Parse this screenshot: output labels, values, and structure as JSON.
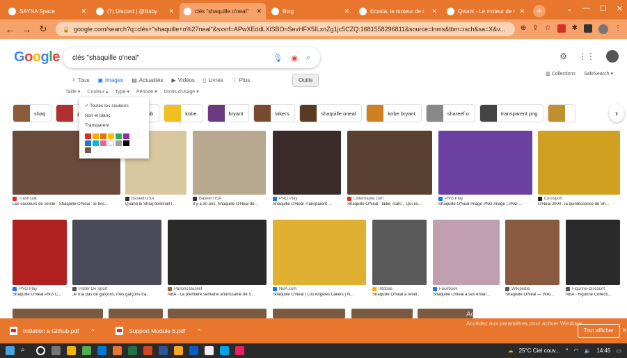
{
  "tabs": [
    {
      "label": "SAYNA Space",
      "icon": "sayna-icon",
      "active": false
    },
    {
      "label": "(7) Discord | @Baby",
      "icon": "discord-icon",
      "active": false
    },
    {
      "label": "clés \"shaquille o'neal\"",
      "icon": "google-icon",
      "active": true
    },
    {
      "label": "Bing",
      "icon": "bing-icon",
      "active": false
    },
    {
      "label": "Ecosia, le moteur de r",
      "icon": "ecosia-icon",
      "active": false
    },
    {
      "label": "Qwant - Le moteur de r",
      "icon": "qwant-icon",
      "active": false
    }
  ],
  "address": {
    "url": "google.com/search?q=clés+\"shaquille+o%27neal\"&sxsrf=APwXEddLXiSBOnSevHFX5ILxnZg1jc5CZQ:1681558296811&source=lnms&tbm=isch&sa=X&v..."
  },
  "search": {
    "query": "clés \"shaquille o'neal\""
  },
  "nav": {
    "tous": "Tous",
    "images": "Images",
    "actualites": "Actualités",
    "videos": "Vidéos",
    "livres": "Livres",
    "plus": "Plus",
    "outils": "Outils",
    "collections": "Collections",
    "safesearch": "SafeSearch ▾"
  },
  "filters": {
    "taille": "Taille ▾",
    "couleur": "Couleur ▴",
    "type": "Type ▾",
    "periode": "Période ▾",
    "droits": "Droits d'usage ▾"
  },
  "dropdown": {
    "items": [
      "Toutes les couleurs",
      "Noir et blanc",
      "Transparent"
    ],
    "swatches": [
      "#d93025",
      "#f9ab00",
      "#e37400",
      "#fbbc04",
      "#34a853",
      "#9c27b0",
      "#1a73e8",
      "#00bcd4",
      "#f06292",
      "#ffffff",
      "#9e9e9e",
      "#000000",
      "#795548"
    ]
  },
  "chips": [
    {
      "label": "shaq",
      "color": "#8a5a3a"
    },
    {
      "label": "p",
      "color": "#b03030"
    },
    {
      "label": "chateau nightclub",
      "color": "#333"
    },
    {
      "label": "kobe",
      "color": "#f0c020"
    },
    {
      "label": "bryant",
      "color": "#6a3a80"
    },
    {
      "label": "lakers",
      "color": "#7a4a30"
    },
    {
      "label": "shaquille oneal",
      "color": "#5a3a20"
    },
    {
      "label": "kobe bryant",
      "color": "#d08020"
    },
    {
      "label": "shareef o",
      "color": "#888"
    },
    {
      "label": "transparent png",
      "color": "#444"
    },
    {
      "label": "",
      "color": "#c09030"
    }
  ],
  "row1": [
    {
      "source": "TrashTalk",
      "caption": "Les casseurs de cercle - Shaquille O'Neal : le bos...",
      "color": "#6a4a3a",
      "dot": "#d93025"
    },
    {
      "source": "",
      "caption": "",
      "color": "#e8b030",
      "dot": "#333"
    },
    {
      "source": "Basket USA",
      "caption": "Quand le Shaq dominait l...",
      "color": "#d9c7a0",
      "dot": "#333"
    },
    {
      "source": "Basket USA",
      "caption": "Il y a 30 ans, Shaquille O'Neal dé...",
      "color": "#b8a890",
      "dot": "#333"
    },
    {
      "source": "PNG Play",
      "caption": "Shaquille O'Neal Transparent ...",
      "color": "#3a2a2a",
      "dot": "#1a73e8"
    },
    {
      "source": "Linternaute.com",
      "caption": "Shaquille O'Neal : taille, stats... Qui es...",
      "color": "#5a4030",
      "dot": "#d93025"
    },
    {
      "source": "PNG Play",
      "caption": "Shaquille O'Neal Image PNG Image | PNG ...",
      "color": "#6a40a0",
      "dot": "#1a73e8"
    },
    {
      "source": "Eurosport",
      "caption": "O'Neal 2000 : la quintessence de Sh...",
      "color": "#d0a020",
      "dot": "#222"
    }
  ],
  "row2": [
    {
      "source": "PNG Play",
      "caption": "Shaquille O'Neal PNG C...",
      "color": "#b02020",
      "dot": "#1a73e8"
    },
    {
      "source": "Parler De Sport",
      "caption": "Je n'ai pas de garçons, mes garçons tra...",
      "color": "#4a4a5a",
      "dot": "#555"
    },
    {
      "source": "Parions Basket",
      "caption": "NBA - La première semaine ahurissante de S...",
      "color": "#2a2a2a",
      "dot": "#8a6a30"
    },
    {
      "source": "NBA.com",
      "caption": "Shaquille O'Neal | Los Angeles Lakers | N...",
      "color": "#e0b030",
      "dot": "#1a73e8"
    },
    {
      "source": "Infobae",
      "caption": "Shaquille O'Neal a révél...",
      "color": "#5a5a5a",
      "dot": "#f9ab00"
    },
    {
      "source": "Facebook",
      "caption": "Shaquille O'Neal a ses enfan...",
      "color": "#c0a0b0",
      "dot": "#1a73e8"
    },
    {
      "source": "Wikipédia",
      "caption": "Shaquille O'Neal — Wiki...",
      "color": "#8a5a40",
      "dot": "#555"
    },
    {
      "source": "Figurine-Discount",
      "caption": "NBA - Figurine Collecti...",
      "color": "#2a2a2a",
      "dot": "#555"
    }
  ],
  "downloads": [
    {
      "name": "Initiation à Github.pdf"
    },
    {
      "name": "Support Module 6.pdf"
    }
  ],
  "watermark": {
    "line1": "Activer Windows",
    "line2": "Accédez aux paramètres pour activer Windows."
  },
  "tout_afficher": "Tout afficher",
  "tray": {
    "weather": "25°C Ciel couv...",
    "time": "14:45"
  }
}
